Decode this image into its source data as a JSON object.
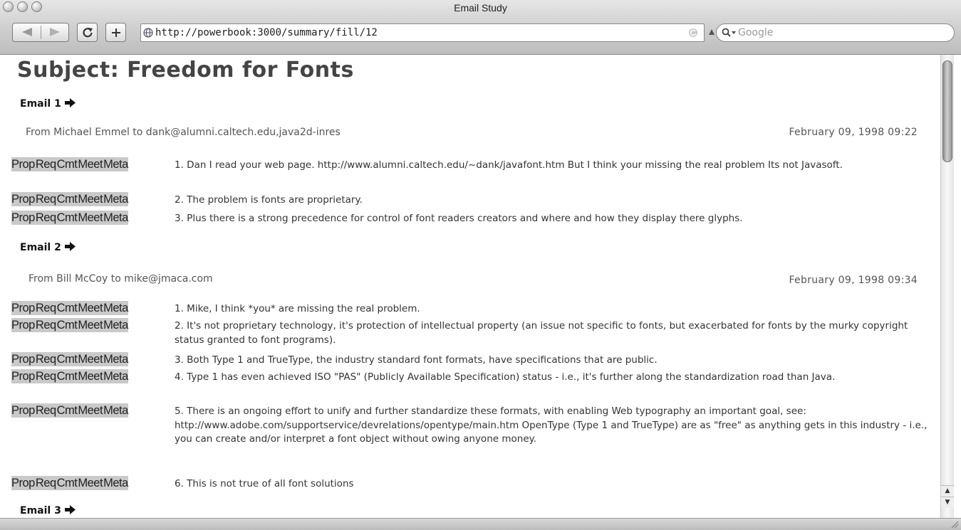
{
  "window": {
    "title": "Email Study"
  },
  "toolbar": {
    "url": "http://powerbook:3000/summary/fill/12",
    "search_placeholder": "Google"
  },
  "page": {
    "subject": "Subject: Freedom for Fonts",
    "tag_labels": [
      "Prop",
      "Req",
      "Cmt",
      "Meet",
      "Meta"
    ],
    "emails": [
      {
        "label": "Email 1",
        "from": "From Michael Emmel to dank@alumni.caltech.edu,java2d-inres",
        "date": "February 09, 1998 09:22",
        "sentences": [
          "1. Dan I read your web page. http://www.alumni.caltech.edu/~dank/javafont.htm But I think your missing the real problem Its not Javasoft.",
          "2. The problem is fonts are proprietary.",
          "3. Plus there is a strong precedence for control of font readers creators and where and how they display there glyphs."
        ]
      },
      {
        "label": "Email 2",
        "from": "From Bill McCoy to mike@jmaca.com",
        "date": "February 09, 1998 09:34",
        "sentences": [
          "1. Mike, I think *you* are missing the real problem.",
          "2. It's not proprietary technology, it's protection of intellectual property (an issue not specific to fonts, but exacerbated for fonts by the murky copyright status granted to font programs).",
          "3. Both Type 1 and TrueType, the industry standard font formats, have specifications that are public.",
          "4. Type 1 has even achieved ISO \"PAS\" (Publicly Available Specification) status - i.e., it's further along the standardization road than Java.",
          "5. There is an ongoing effort to unify and further standardize these formats, with enabling Web typography an important goal, see: http://www.adobe.com/supportservice/devrelations/opentype/main.htm OpenType (Type 1 and TrueType) are as \"free\" as anything gets in this industry - i.e., you can create and/or interpret a font object without owing anyone money.",
          "6. This is not true of all font solutions"
        ]
      },
      {
        "label": "Email 3"
      }
    ]
  }
}
